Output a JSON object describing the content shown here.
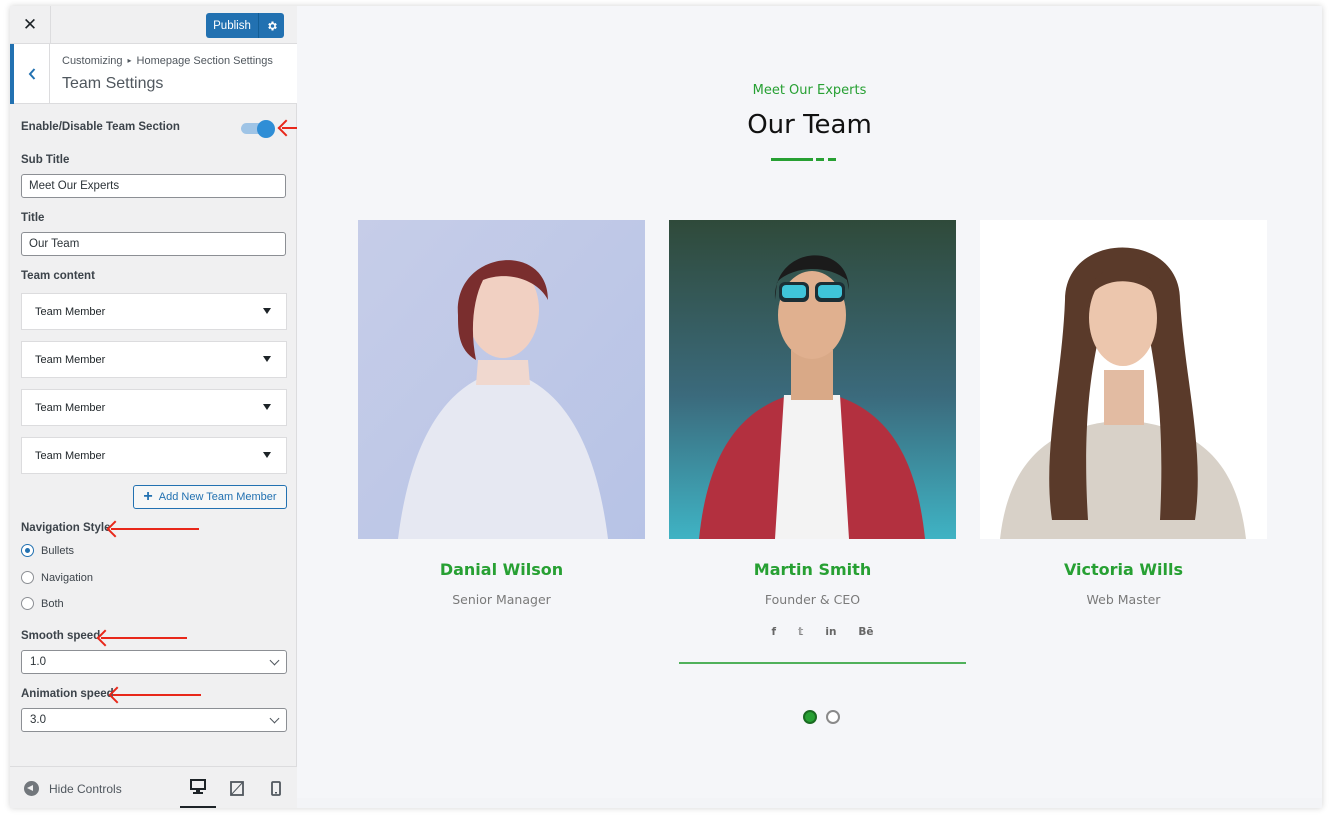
{
  "topbar": {
    "close_glyph": "✕",
    "publish_label": "Publish",
    "gear_icon": "gear-icon"
  },
  "header": {
    "crumb_root": "Customizing",
    "crumb_sep": "▸",
    "crumb_section": "Homepage Section Settings",
    "title": "Team Settings"
  },
  "controls": {
    "enable_label": "Enable/Disable Team Section",
    "enable_on": true,
    "subtitle_label": "Sub Title",
    "subtitle_value": "Meet Our Experts",
    "title_label": "Title",
    "title_value": "Our Team",
    "content_label": "Team content",
    "members": [
      "Team Member",
      "Team Member",
      "Team Member",
      "Team Member"
    ],
    "add_label": "Add New Team Member",
    "nav_label": "Navigation Style",
    "nav_options": [
      "Bullets",
      "Navigation",
      "Both"
    ],
    "nav_selected": "Bullets",
    "smooth_label": "Smooth speed",
    "smooth_value": "1.0",
    "anim_label": "Animation speed",
    "anim_value": "3.0"
  },
  "footer": {
    "hide_label": "Hide Controls"
  },
  "preview": {
    "subtitle": "Meet Our Experts",
    "title": "Our Team",
    "accent": "#27a033",
    "team": [
      {
        "name": "Danial Wilson",
        "role": "Senior Manager"
      },
      {
        "name": "Martin Smith",
        "role": "Founder & CEO"
      },
      {
        "name": "Victoria Wills",
        "role": "Web Master"
      }
    ],
    "socials": [
      "f",
      "𝕥",
      "in",
      "Bē"
    ]
  }
}
